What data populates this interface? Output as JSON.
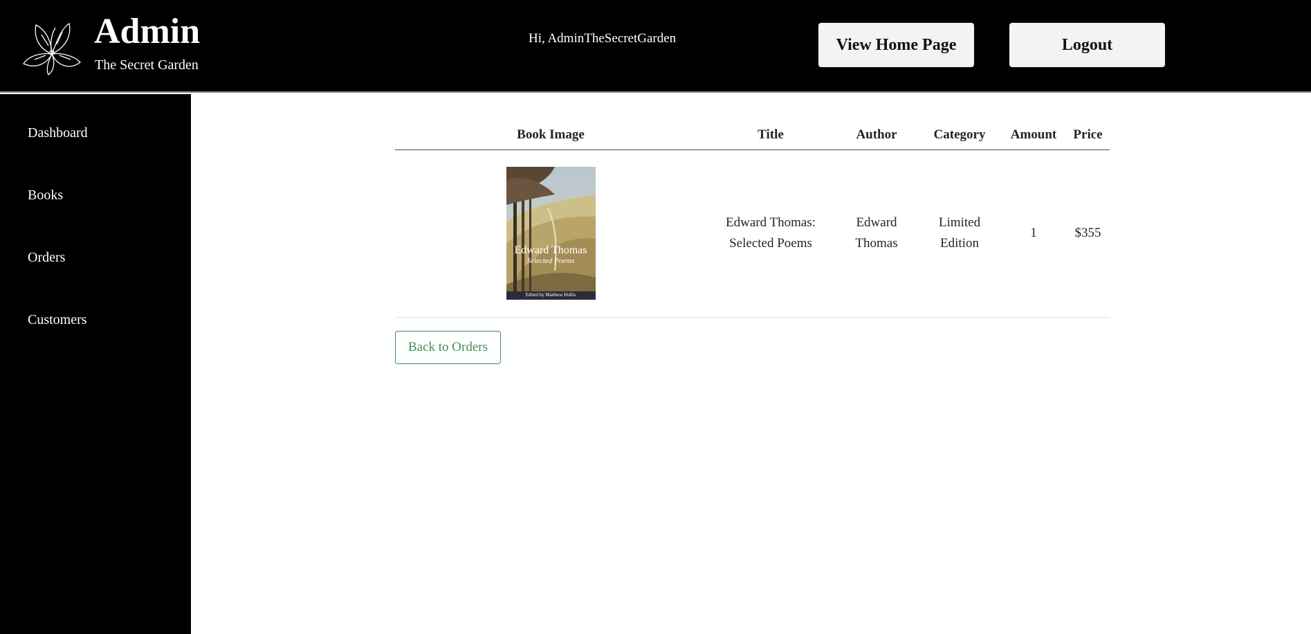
{
  "brand": {
    "title": "Admin",
    "subtitle": "The Secret Garden"
  },
  "header": {
    "greeting": "Hi, AdminTheSecretGarden",
    "home_label": "View Home Page",
    "logout_label": "Logout"
  },
  "sidebar": {
    "items": [
      {
        "label": "Dashboard"
      },
      {
        "label": "Books"
      },
      {
        "label": "Orders"
      },
      {
        "label": "Customers"
      }
    ]
  },
  "table": {
    "headers": [
      "Book Image",
      "Title",
      "Author",
      "Category",
      "Amount",
      "Price"
    ],
    "rows": [
      {
        "cover_title": "Edward Thomas",
        "cover_subtitle": "Selected Poems",
        "cover_credit": "Edited by Matthew Hollis",
        "title_line1": "Edward Thomas:",
        "title_line2": "Selected Poems",
        "author_line1": "Edward",
        "author_line2": "Thomas",
        "category_line1": "Limited",
        "category_line2": "Edition",
        "amount": "1",
        "price": "$355"
      }
    ]
  },
  "actions": {
    "back_label": "Back to Orders"
  },
  "colors": {
    "header_bg": "#000000",
    "accent_green": "#3f8f5a",
    "button_bg": "#f2f3f5"
  }
}
